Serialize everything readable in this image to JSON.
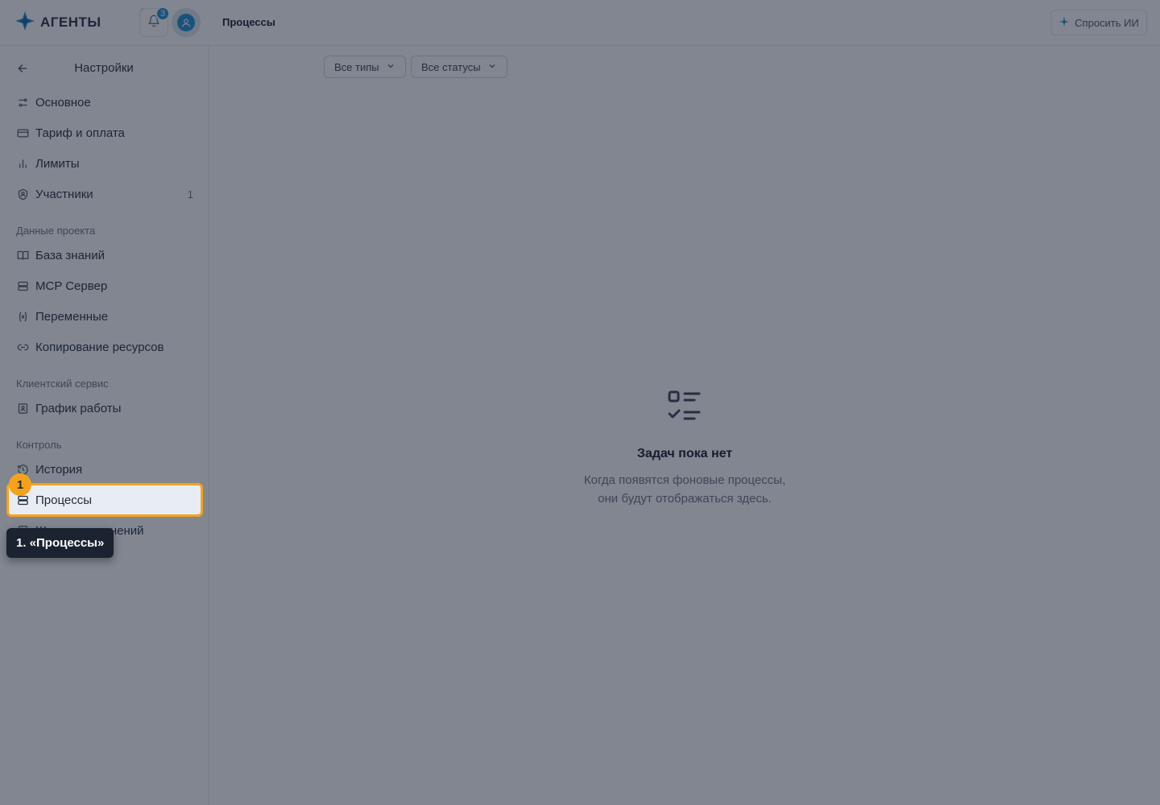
{
  "app": {
    "name": "АГЕНТЫ"
  },
  "header": {
    "title": "Процессы",
    "notifications_count": "3",
    "ask_ai_label": "Спросить ИИ"
  },
  "sidebar": {
    "back_title": "Настройки",
    "items_main": [
      {
        "label": "Основное",
        "icon": "sliders-icon"
      },
      {
        "label": "Тариф и оплата",
        "icon": "credit-card-icon"
      },
      {
        "label": "Лимиты",
        "icon": "bar-chart-icon"
      },
      {
        "label": "Участники",
        "icon": "shield-user-icon",
        "count": "1"
      }
    ],
    "section_project": "Данные проекта",
    "items_project": [
      {
        "label": "База знаний",
        "icon": "book-open-icon"
      },
      {
        "label": "MCP Сервер",
        "icon": "server-icon"
      },
      {
        "label": "Переменные",
        "icon": "variable-icon"
      },
      {
        "label": "Копирование ресурсов",
        "icon": "link-icon"
      }
    ],
    "section_client": "Клиентский сервис",
    "items_client": [
      {
        "label": "График работы",
        "icon": "calendar-icon"
      }
    ],
    "section_control": "Контроль",
    "items_control": [
      {
        "label": "История",
        "icon": "history-icon"
      },
      {
        "label": "Процессы",
        "icon": "server-stack-icon",
        "active": true
      },
      {
        "label": "Журнал изменений",
        "icon": "log-icon"
      }
    ]
  },
  "filters": {
    "types_label": "Все типы",
    "statuses_label": "Все статусы"
  },
  "empty_state": {
    "title": "Задач пока нет",
    "line1": "Когда появятся фоновые процессы,",
    "line2": "они будут отображаться здесь."
  },
  "walkthrough": {
    "step_number": "1",
    "tooltip_text": "1. «Процессы»",
    "highlight_color": "#f5a21b"
  },
  "colors": {
    "accent": "#1a8fd6",
    "overlay": "rgba(25, 35, 52, 0.55)"
  }
}
